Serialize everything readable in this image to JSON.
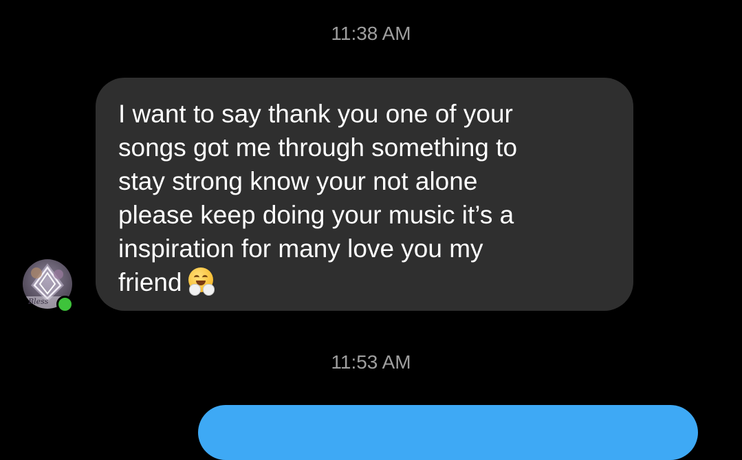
{
  "conversation": {
    "timestamps": [
      "11:38 AM",
      "11:53 AM"
    ],
    "received_message": {
      "lines": [
        "I want to say thank you one of your",
        "songs got me through something to",
        "stay strong know your not alone",
        "please keep doing your music it’s a",
        "inspiration for many love you my",
        "friend"
      ],
      "emoji": "smiling-face-with-open-hands-emoji"
    },
    "sender": {
      "avatar_icon": "profile-avatar",
      "avatar_text": "Bless",
      "online": true
    },
    "outgoing_message": {
      "color": "#3ea9f5"
    }
  },
  "colors": {
    "background": "#000000",
    "incoming_bubble": "#2f2f2f",
    "timestamp_text": "#9e9e9e",
    "online_indicator": "#3ec33b",
    "outgoing_bubble": "#3ea9f5"
  }
}
